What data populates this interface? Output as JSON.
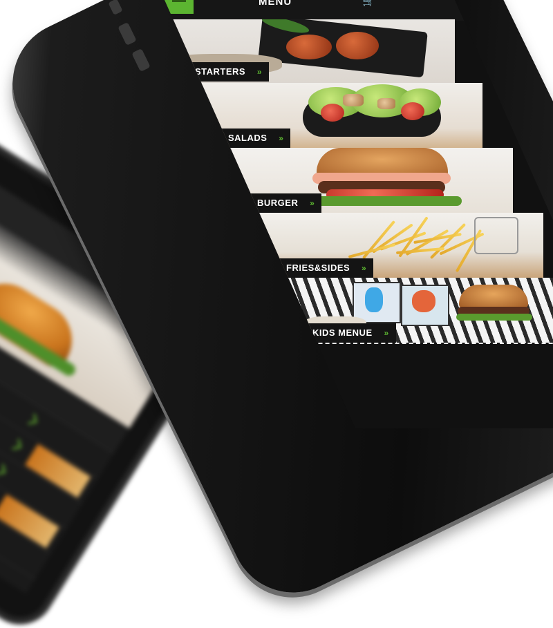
{
  "app": {
    "title": "MENU",
    "menu_icon": "hamburger-menu-icon",
    "cart_icon": "cart-icon"
  },
  "categories": [
    {
      "label": "STARTERS",
      "arrow": "»"
    },
    {
      "label": "SALADS",
      "arrow": "»"
    },
    {
      "label": "BURGER",
      "arrow": "»"
    },
    {
      "label": "FRIES&SIDES",
      "arrow": "»"
    },
    {
      "label": "KIDS MENUE",
      "arrow": "»"
    }
  ],
  "colors": {
    "accent": "#5cb531",
    "label_bg": "#141414",
    "screen_bg": "#111111"
  }
}
